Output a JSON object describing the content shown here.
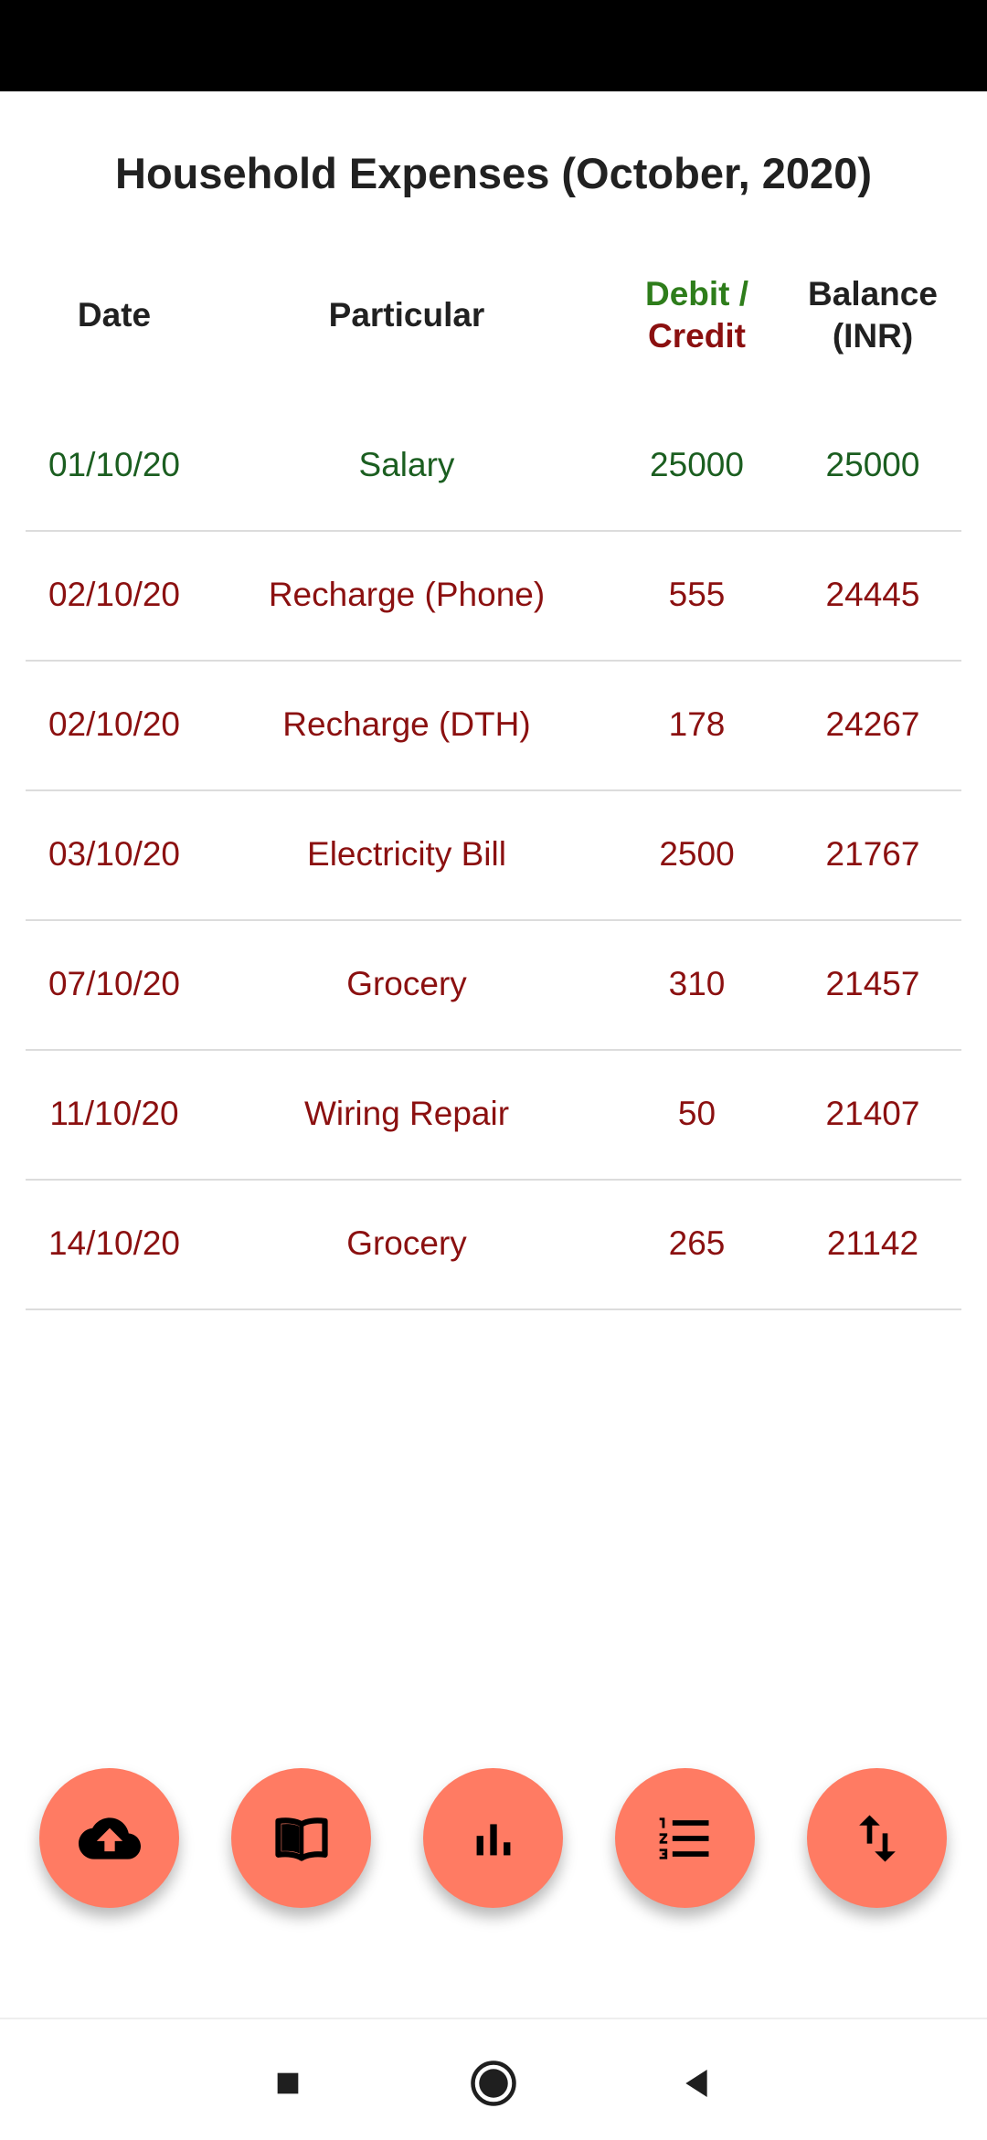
{
  "title": "Household Expenses (October, 2020)",
  "colors": {
    "credit": "#1b5e20",
    "debit": "#8b1010",
    "fab": "#ff7b63"
  },
  "header": {
    "date": "Date",
    "particular": "Particular",
    "debit": "Debit /",
    "credit": "Credit",
    "balance_line1": "Balance",
    "balance_line2": "(INR)"
  },
  "rows": [
    {
      "date": "01/10/20",
      "particular": "Salary",
      "amount": "25000",
      "balance": "25000",
      "type": "credit"
    },
    {
      "date": "02/10/20",
      "particular": "Recharge (Phone)",
      "amount": "555",
      "balance": "24445",
      "type": "debit"
    },
    {
      "date": "02/10/20",
      "particular": "Recharge (DTH)",
      "amount": "178",
      "balance": "24267",
      "type": "debit"
    },
    {
      "date": "03/10/20",
      "particular": "Electricity Bill",
      "amount": "2500",
      "balance": "21767",
      "type": "debit"
    },
    {
      "date": "07/10/20",
      "particular": "Grocery",
      "amount": "310",
      "balance": "21457",
      "type": "debit"
    },
    {
      "date": "11/10/20",
      "particular": "Wiring Repair",
      "amount": "50",
      "balance": "21407",
      "type": "debit"
    },
    {
      "date": "14/10/20",
      "particular": "Grocery",
      "amount": "265",
      "balance": "21142",
      "type": "debit"
    }
  ],
  "fabs": [
    "cloud-upload-icon",
    "book-icon",
    "bar-chart-icon",
    "numbered-list-icon",
    "sort-arrows-icon"
  ],
  "nav": [
    "recents-square-icon",
    "home-circle-icon",
    "back-triangle-icon"
  ]
}
